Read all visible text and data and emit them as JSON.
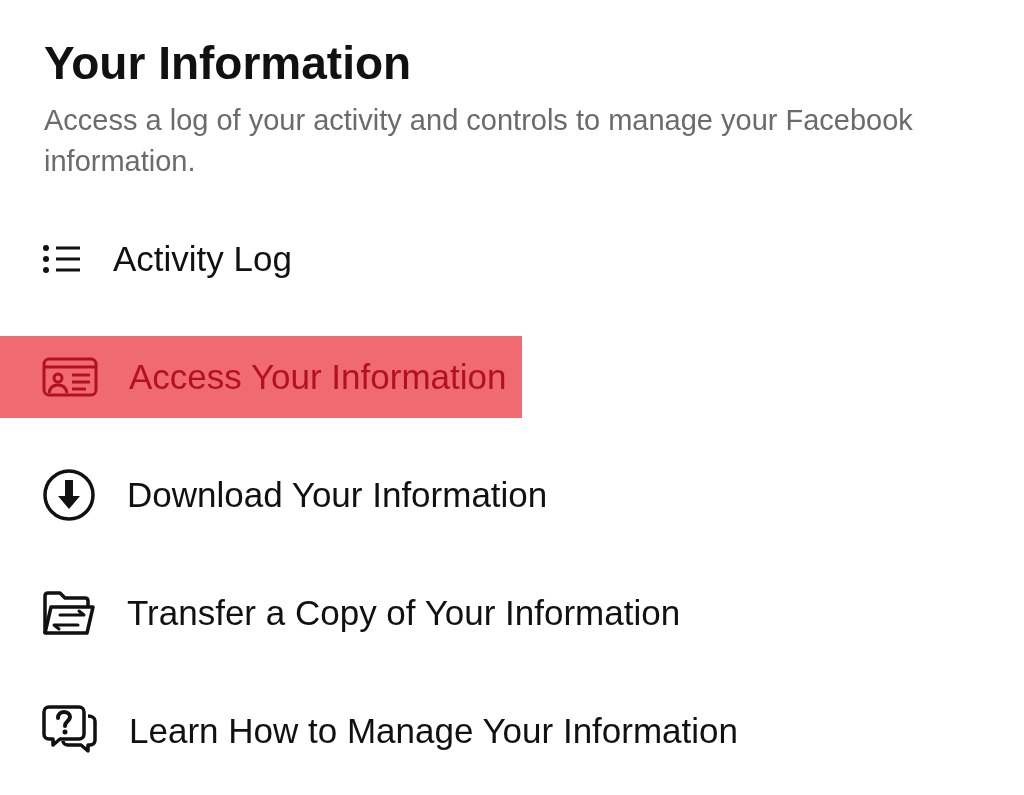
{
  "section": {
    "title": "Your Information",
    "description": "Access a log of your activity and controls to manage your Facebook information."
  },
  "items": [
    {
      "kind": "list",
      "label": "Activity Log",
      "selected": false
    },
    {
      "kind": "id-card",
      "label": "Access Your Information",
      "selected": true
    },
    {
      "kind": "download",
      "label": "Download Your Information",
      "selected": false
    },
    {
      "kind": "transfer",
      "label": "Transfer a Copy of Your Information",
      "selected": false
    },
    {
      "kind": "help",
      "label": "Learn How to Manage Your Information",
      "selected": false
    }
  ]
}
